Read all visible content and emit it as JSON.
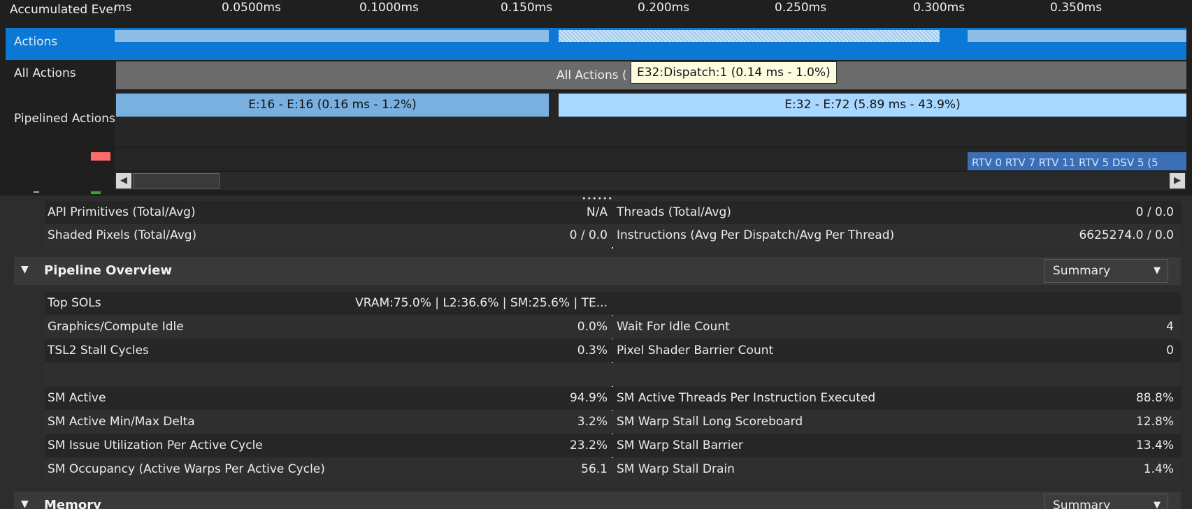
{
  "timeline": {
    "accumulated_label": "Accumulated Events",
    "ruler_ticks": [
      "0.0500ms",
      "0.1000ms",
      "0.150ms",
      "0.200ms",
      "0.250ms",
      "0.300ms",
      "0.350ms"
    ],
    "ruler_partial_tick": "ms",
    "rows": {
      "actions": "Actions",
      "all_actions": "All Actions",
      "pipelined": "Pipelined Actions"
    },
    "all_actions_bar": "All Actions (",
    "pipelined_bars": [
      "E:16 - E:16 (0.16 ms - 1.2%)",
      "E:32 - E:72 (5.89 ms - 43.9%)"
    ],
    "partial_bar_text": "RTV 0 RTV 7 RTV 11 RTV 5 DSV 5 (5",
    "tooltip": "E32:Dispatch:1 (0.14 ms - 1.0%)",
    "splitter_grip": "••••••"
  },
  "top_rows": [
    {
      "l_label": "API Primitives (Total/Avg)",
      "l_val": "N/A",
      "r_label": "Threads (Total/Avg)",
      "r_val": "0 / 0.0"
    },
    {
      "l_label": "Shaded Pixels (Total/Avg)",
      "l_val": "0 / 0.0",
      "r_label": "Instructions (Avg Per Dispatch/Avg Per Thread)",
      "r_val": "6625274.0 / 0.0"
    }
  ],
  "pipeline": {
    "title": "Pipeline Overview",
    "dropdown_value": "Summary",
    "rows": [
      {
        "l_label": "Top SOLs",
        "l_val": "VRAM:75.0% | L2:36.6% | SM:25.6% | TE...",
        "r_label": "",
        "r_val": ""
      },
      {
        "l_label": "Graphics/Compute Idle",
        "l_val": "0.0%",
        "r_label": "Wait For Idle Count",
        "r_val": "4"
      },
      {
        "l_label": "TSL2 Stall Cycles",
        "l_val": "0.3%",
        "r_label": "Pixel Shader Barrier Count",
        "r_val": "0"
      },
      {
        "l_label": "",
        "l_val": "",
        "r_label": "",
        "r_val": ""
      },
      {
        "l_label": "SM Active",
        "l_val": "94.9%",
        "r_label": "SM Active Threads Per Instruction Executed",
        "r_val": "88.8%"
      },
      {
        "l_label": "SM Active Min/Max Delta",
        "l_val": "3.2%",
        "r_label": "SM Warp Stall Long Scoreboard",
        "r_val": "12.8%"
      },
      {
        "l_label": "SM Issue Utilization Per Active Cycle",
        "l_val": "23.2%",
        "r_label": "SM Warp Stall Barrier",
        "r_val": "13.4%"
      },
      {
        "l_label": "SM Occupancy (Active Warps Per Active Cycle)",
        "l_val": "56.1",
        "r_label": "SM Warp Stall Drain",
        "r_val": "1.4%"
      }
    ]
  },
  "memory": {
    "title": "Memory",
    "dropdown_value": "Summary"
  },
  "colors": {
    "selection_blue": "#0a78d4",
    "bar_blue": "#7ab0e0",
    "bar_light_blue": "#a8d8ff",
    "bar_gray": "#6b6b6b",
    "status_red": "#ff6b6b",
    "status_green": "#2fa82f"
  }
}
